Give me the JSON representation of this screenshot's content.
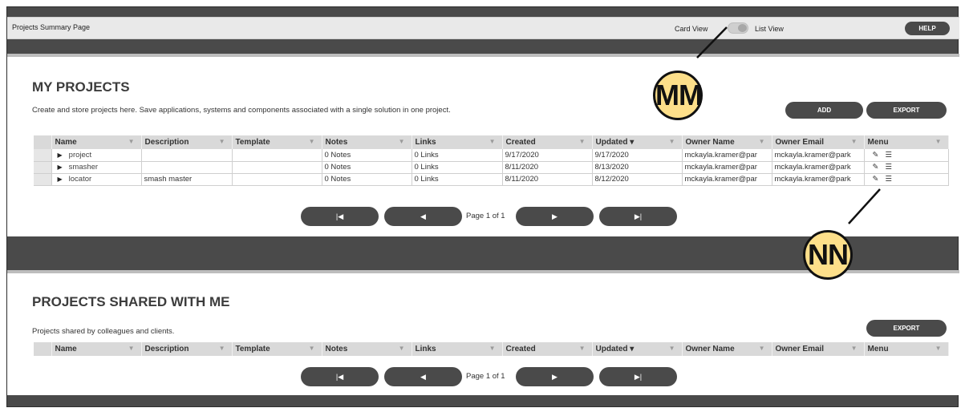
{
  "header": {
    "app_title": "Projects Summary Page",
    "card_view_label": "Card View",
    "list_view_label": "List View",
    "help_label": "HELP"
  },
  "my_projects": {
    "title": "MY PROJECTS",
    "description": "Create and store projects here. Save applications, systems and components associated with a single solution in one project.",
    "add_label": "ADD",
    "export_label": "EXPORT",
    "columns": [
      "Name",
      "Description",
      "Template",
      "Notes",
      "Links",
      "Created",
      "Updated ▾",
      "Owner Name",
      "Owner Email",
      "Menu"
    ],
    "rows": [
      {
        "name": "project",
        "description": "",
        "template": "",
        "notes": "0 Notes",
        "links": "0 Links",
        "created": "9/17/2020",
        "updated": "9/17/2020",
        "owner_name": "mckayla.kramer@par",
        "owner_email": "mckayla.kramer@park"
      },
      {
        "name": "smasher",
        "description": "",
        "template": "",
        "notes": "0 Notes",
        "links": "0 Links",
        "created": "8/11/2020",
        "updated": "8/13/2020",
        "owner_name": "mckayla.kramer@par",
        "owner_email": "mckayla.kramer@park"
      },
      {
        "name": "locator",
        "description": "smash master",
        "template": "",
        "notes": "0 Notes",
        "links": "0 Links",
        "created": "8/11/2020",
        "updated": "8/12/2020",
        "owner_name": "mckayla.kramer@par",
        "owner_email": "mckayla.kramer@park"
      }
    ],
    "pager": {
      "first": "|◀",
      "prev": "◀",
      "page_label": "Page 1 of 1",
      "next": "▶",
      "last": "▶|"
    }
  },
  "shared": {
    "title": "PROJECTS SHARED WITH ME",
    "description": "Projects shared by colleagues and clients.",
    "export_label": "EXPORT",
    "columns": [
      "Name",
      "Description",
      "Template",
      "Notes",
      "Links",
      "Created",
      "Updated ▾",
      "Owner Name",
      "Owner Email",
      "Menu"
    ],
    "pager": {
      "first": "|◀",
      "prev": "◀",
      "page_label": "Page 1 of 1",
      "next": "▶",
      "last": "▶|"
    }
  },
  "callouts": {
    "mm": "MM",
    "nn": "NN"
  },
  "icons": {
    "edit": "pencil-icon",
    "menu": "hamburger-icon",
    "expand": "caret-right-icon",
    "filter": "filter-icon"
  },
  "colors": {
    "dark": "#4a4a4a",
    "callout_fill": "#fddf8a",
    "header_cell": "#d9d9d9"
  }
}
